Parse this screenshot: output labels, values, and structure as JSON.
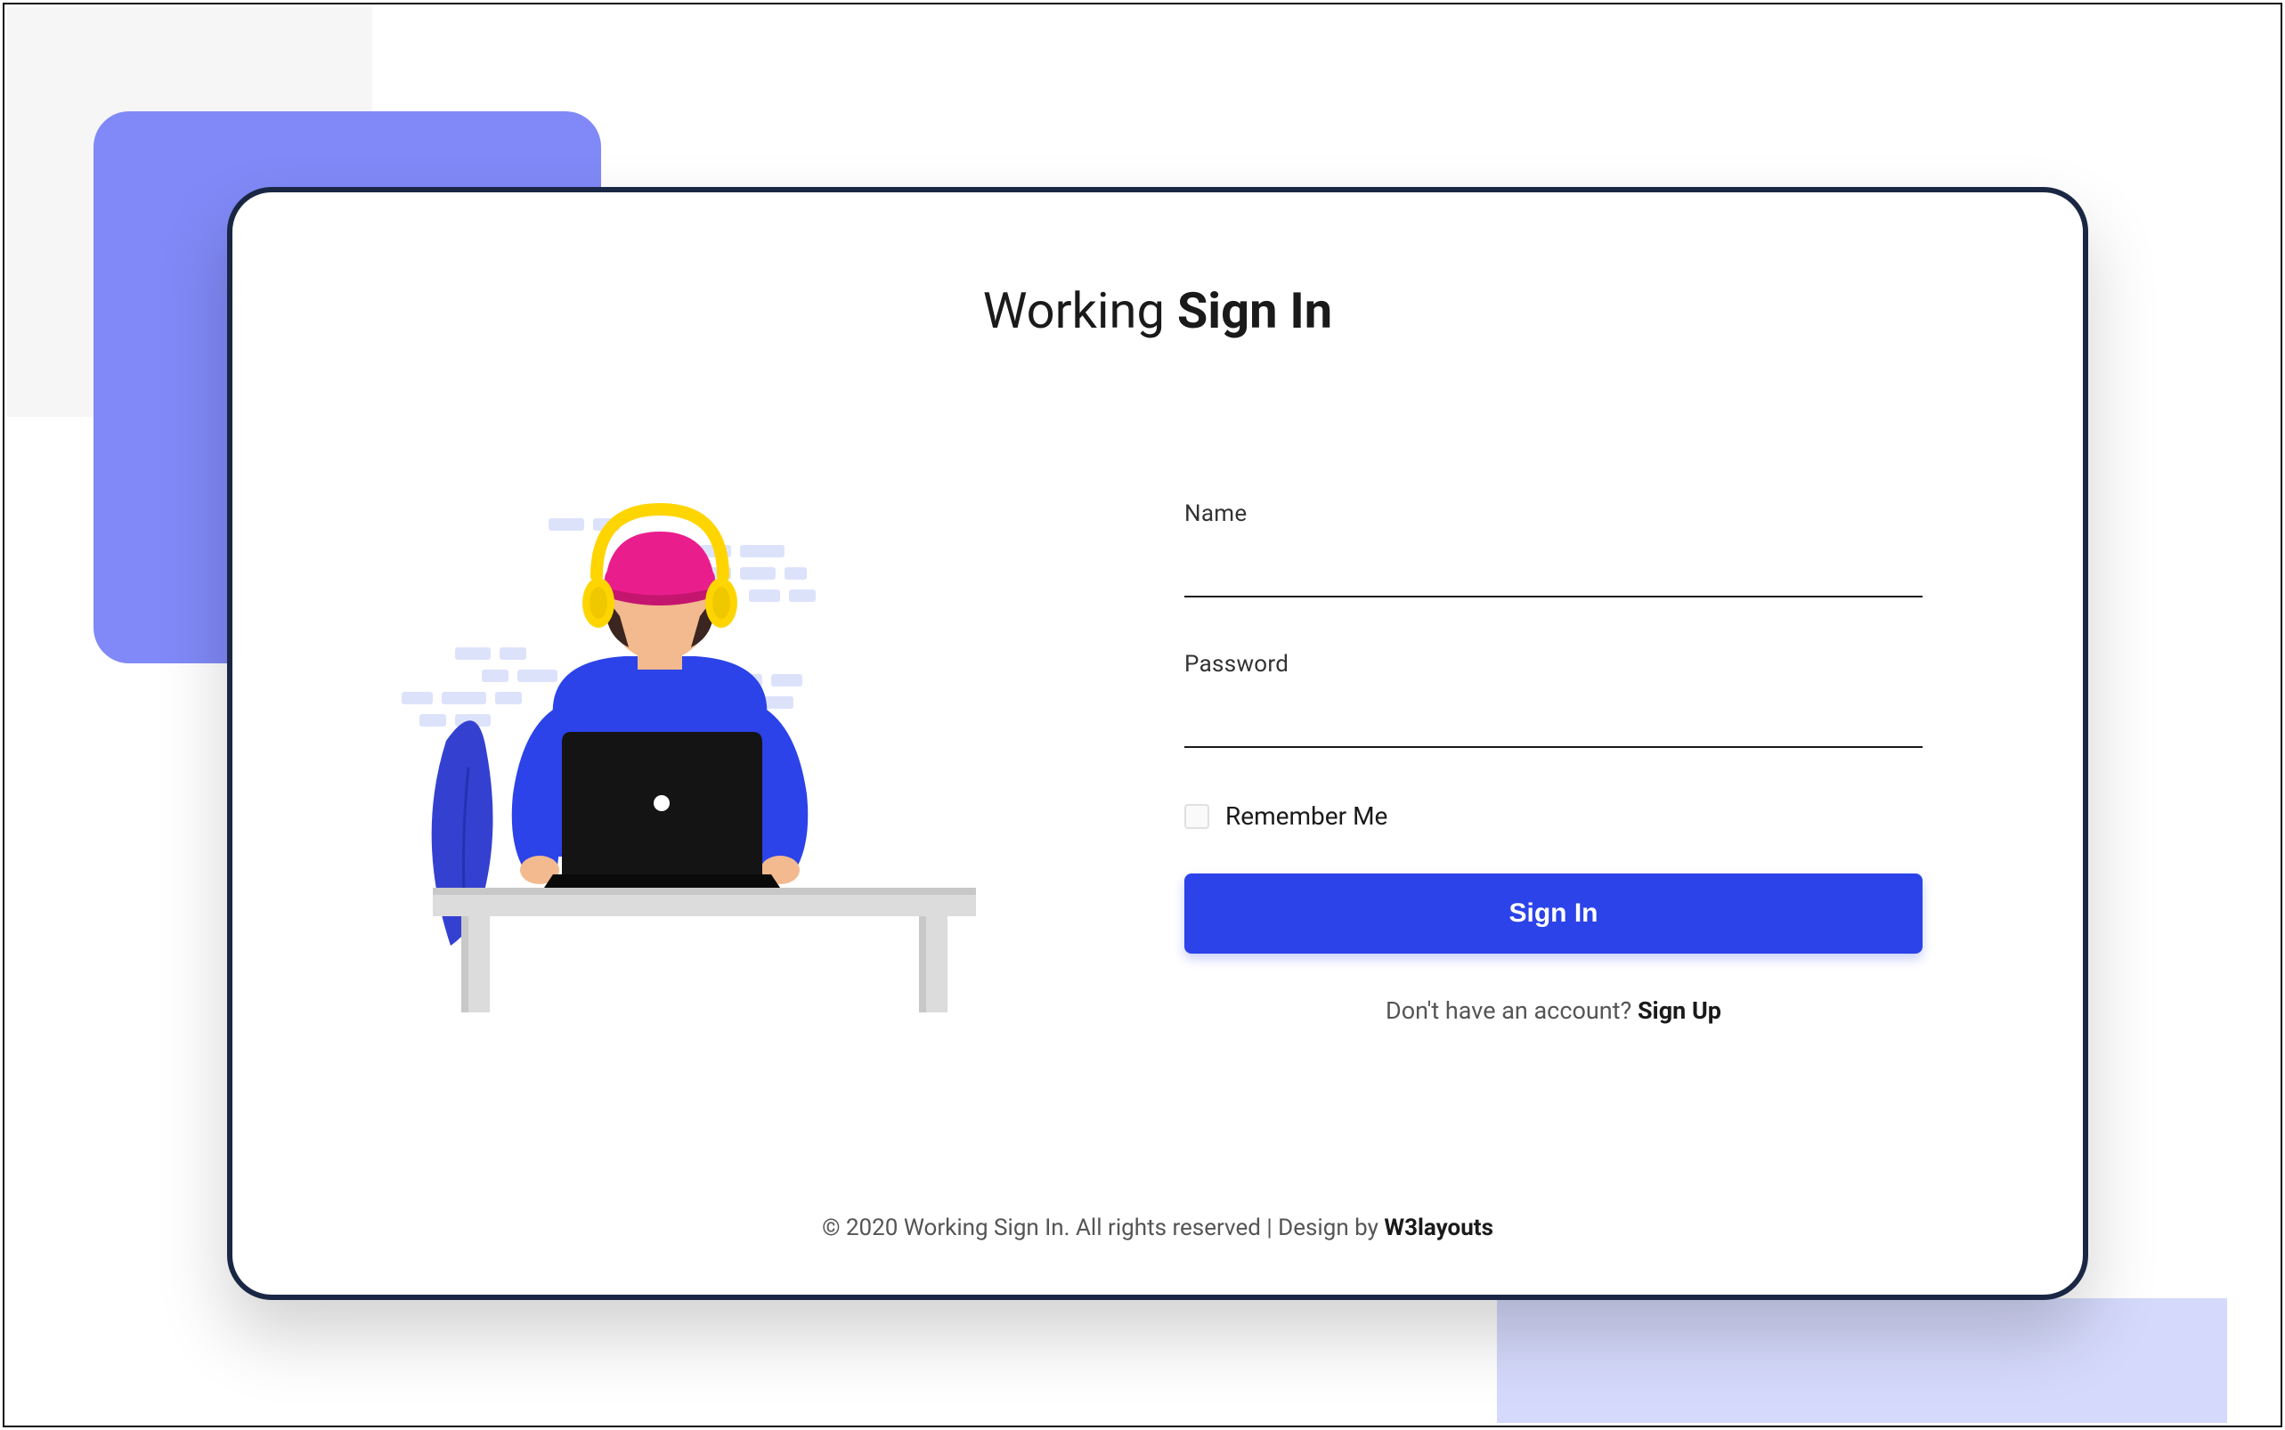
{
  "title": {
    "prefix": "Working ",
    "bold": "Sign In"
  },
  "form": {
    "name_label": "Name",
    "password_label": "Password",
    "remember_label": "Remember Me",
    "signin_button_label": "Sign In"
  },
  "signup": {
    "prompt": "Don't have an account? ",
    "link": "Sign Up"
  },
  "footer": {
    "text": "© 2020 Working Sign In. All rights reserved | Design by ",
    "link": "W3layouts"
  },
  "colors": {
    "accent": "#2b43e8",
    "purple_decor": "#8089f7",
    "card_border": "#1a2744"
  }
}
